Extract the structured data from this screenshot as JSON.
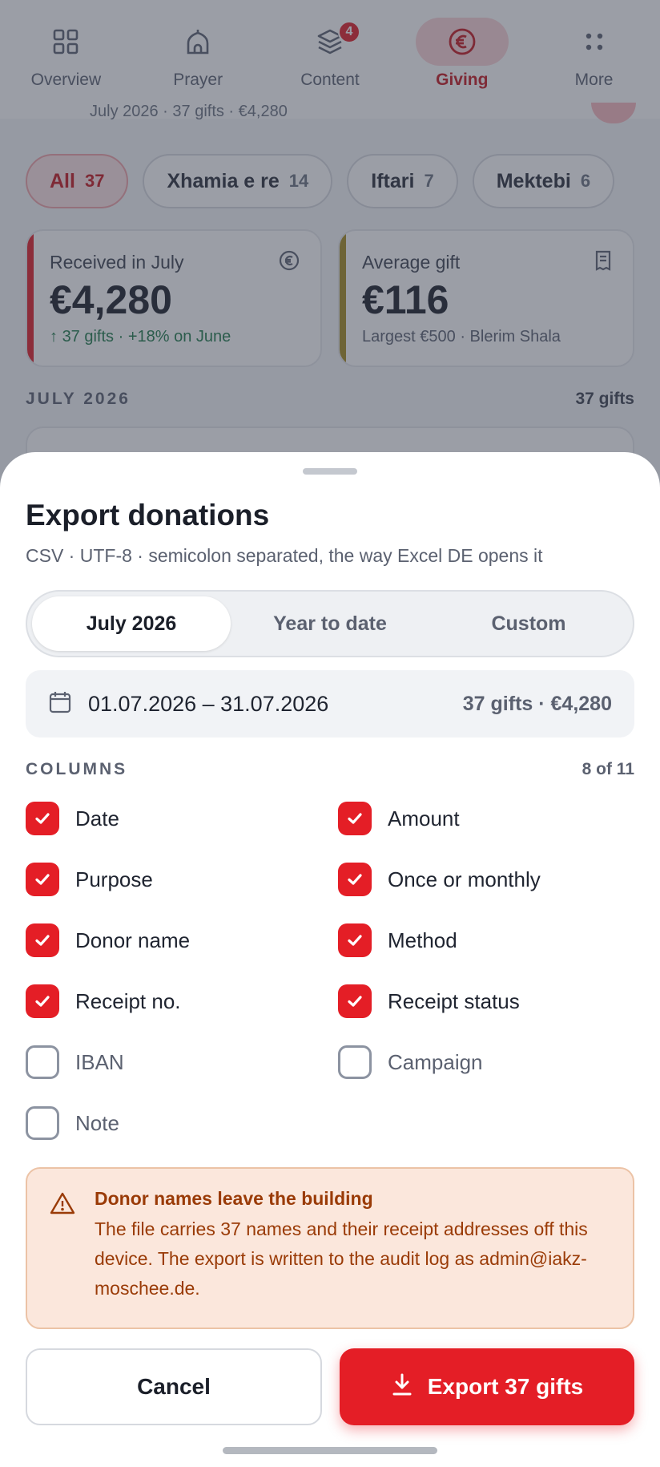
{
  "nav": {
    "items": [
      {
        "label": "Overview",
        "icon": "grid-icon"
      },
      {
        "label": "Prayer",
        "icon": "mosque-icon"
      },
      {
        "label": "Content",
        "icon": "layers-icon",
        "badge": "4"
      },
      {
        "label": "Giving",
        "icon": "euro-icon",
        "active": true
      },
      {
        "label": "More",
        "icon": "dots-icon"
      }
    ]
  },
  "background": {
    "partial_row": "July 2026 · 37 gifts · €4,280",
    "chips": [
      {
        "label": "All",
        "count": "37",
        "active": true
      },
      {
        "label": "Xhamia e re",
        "count": "14"
      },
      {
        "label": "Iftari",
        "count": "7"
      },
      {
        "label": "Mektebi",
        "count": "6"
      }
    ],
    "stats": [
      {
        "label": "Received in July",
        "value": "€4,280",
        "sub": "37 gifts · +18% on June",
        "accent": "#e11d26",
        "icon": "euro-circle-icon"
      },
      {
        "label": "Average gift",
        "value": "€116",
        "sub": "Largest €500 · Blerim Shala",
        "accent": "#a58a1e",
        "icon": "receipt-icon"
      }
    ],
    "section_title": "JULY 2026",
    "section_count": "37 gifts"
  },
  "sheet": {
    "title": "Export donations",
    "subtitle": "CSV · UTF-8 · semicolon separated, the way Excel DE opens it",
    "segments": [
      {
        "label": "July 2026",
        "active": true
      },
      {
        "label": "Year to date"
      },
      {
        "label": "Custom"
      }
    ],
    "range": {
      "dates": "01.07.2026 – 31.07.2026",
      "summary": "37 gifts · €4,280"
    },
    "columns_title": "COLUMNS",
    "columns_count": "8 of 11",
    "columns": [
      {
        "label": "Date",
        "checked": true
      },
      {
        "label": "Amount",
        "checked": true
      },
      {
        "label": "Purpose",
        "checked": true
      },
      {
        "label": "Once or monthly",
        "checked": true
      },
      {
        "label": "Donor name",
        "checked": true
      },
      {
        "label": "Method",
        "checked": true
      },
      {
        "label": "Receipt no.",
        "checked": true
      },
      {
        "label": "Receipt status",
        "checked": true
      },
      {
        "label": "IBAN",
        "checked": false
      },
      {
        "label": "Campaign",
        "checked": false
      },
      {
        "label": "Note",
        "checked": false
      }
    ],
    "warning": {
      "title": "Donor names leave the building",
      "body": "The file carries 37 names and their receipt addresses off this device. The export is written to the audit log as admin@iakz-moschee.de."
    },
    "cancel_label": "Cancel",
    "export_label": "Export 37 gifts"
  },
  "colors": {
    "accent": "#e41e26",
    "warning_bg": "#fbe7dc",
    "warning_text": "#9a3b07"
  }
}
